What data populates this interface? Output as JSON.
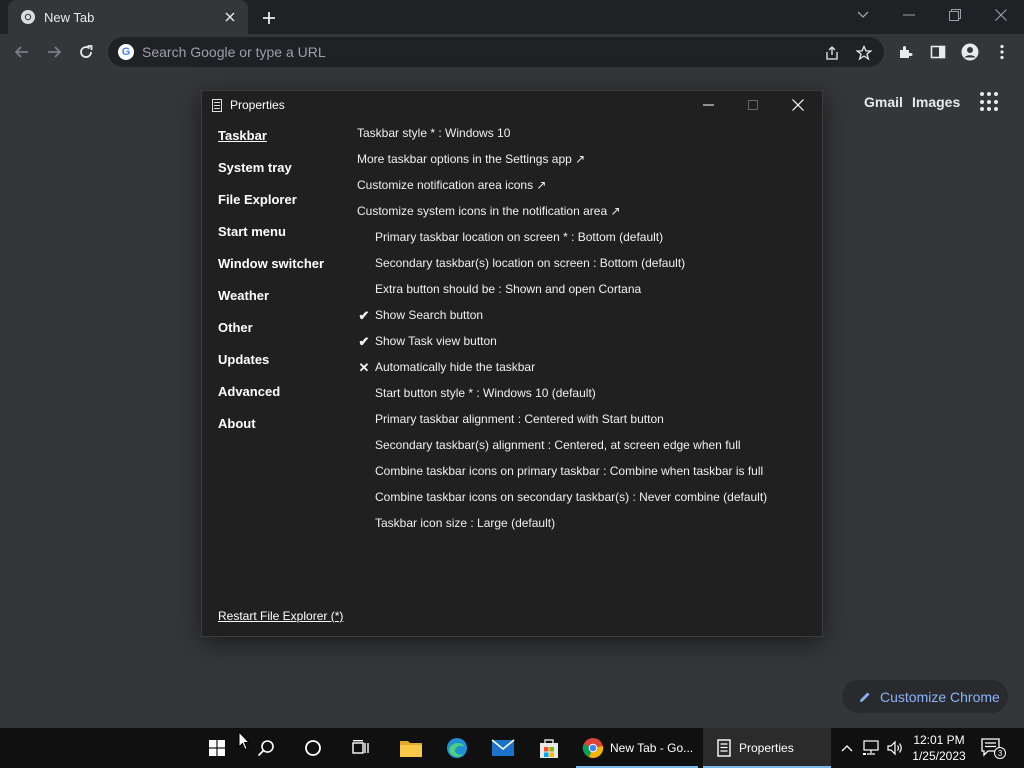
{
  "browser": {
    "tab_title": "New Tab",
    "omnibox_placeholder": "Search Google or type a URL",
    "ntp_links": [
      "Gmail",
      "Images"
    ],
    "customize_label": "Customize Chrome"
  },
  "dialog": {
    "title": "Properties",
    "nav": [
      "Taskbar",
      "System tray",
      "File Explorer",
      "Start menu",
      "Window switcher",
      "Weather",
      "Other",
      "Updates",
      "Advanced",
      "About"
    ],
    "active_nav": "Taskbar",
    "options": [
      {
        "text": "Taskbar style * : Windows 10",
        "mark": "",
        "sub": false
      },
      {
        "text": "More taskbar options in the Settings app ↗",
        "mark": "",
        "sub": false
      },
      {
        "text": "Customize notification area icons ↗",
        "mark": "",
        "sub": false
      },
      {
        "text": "Customize system icons in the notification area ↗",
        "mark": "",
        "sub": false
      },
      {
        "text": "Primary taskbar location on screen * : Bottom (default)",
        "mark": "",
        "sub": true
      },
      {
        "text": "Secondary taskbar(s) location on screen : Bottom (default)",
        "mark": "",
        "sub": true
      },
      {
        "text": "Extra button should be : Shown and open Cortana",
        "mark": "",
        "sub": true
      },
      {
        "text": "Show Search button",
        "mark": "✔",
        "sub": true
      },
      {
        "text": "Show Task view button",
        "mark": "✔",
        "sub": true
      },
      {
        "text": "Automatically hide the taskbar",
        "mark": "✕",
        "sub": true
      },
      {
        "text": "Start button style * : Windows 10 (default)",
        "mark": "",
        "sub": true
      },
      {
        "text": "Primary taskbar alignment : Centered with Start button",
        "mark": "",
        "sub": true
      },
      {
        "text": "Secondary taskbar(s) alignment : Centered, at screen edge when full",
        "mark": "",
        "sub": true
      },
      {
        "text": "Combine taskbar icons on primary taskbar : Combine when taskbar is full",
        "mark": "",
        "sub": true
      },
      {
        "text": "Combine taskbar icons on secondary taskbar(s) : Never combine (default)",
        "mark": "",
        "sub": true
      },
      {
        "text": "Taskbar icon size : Large (default)",
        "mark": "",
        "sub": true
      }
    ],
    "restart_label": "Restart File Explorer (*)"
  },
  "taskbar": {
    "apps": [
      {
        "label": "New Tab - Go...",
        "icon": "chrome-icon"
      },
      {
        "label": "Properties",
        "icon": "properties-icon"
      }
    ],
    "time": "12:01 PM",
    "date": "1/25/2023",
    "notification_count": "3"
  },
  "colors": {
    "chrome_frame": "#202124",
    "chrome_toolbar": "#35363a",
    "dialog_bg": "#202020",
    "taskbar_bg": "#101010",
    "link_blue": "#8ab4f8"
  }
}
